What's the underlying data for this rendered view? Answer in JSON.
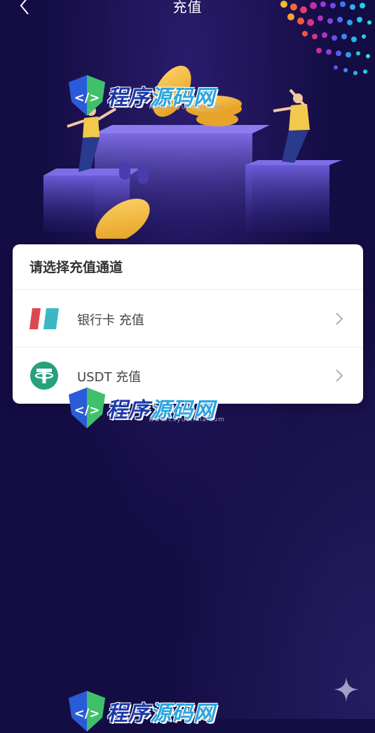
{
  "header": {
    "title": "充值",
    "back_icon": "chevron-left-icon"
  },
  "card": {
    "title": "请选择充值通道",
    "options": [
      {
        "label": "银行卡 充值",
        "icon": "bank-card-icon"
      },
      {
        "label": "USDT 充值",
        "icon": "tether-icon"
      }
    ]
  },
  "watermark": {
    "text_part1": "程序",
    "text_part2": "源码网",
    "url": "www.cxyuanma.com"
  },
  "colors": {
    "background": "#140d44",
    "card": "#ffffff",
    "tether": "#26a17b",
    "bank_red": "#e0464f",
    "bank_teal": "#3bb8c4"
  }
}
